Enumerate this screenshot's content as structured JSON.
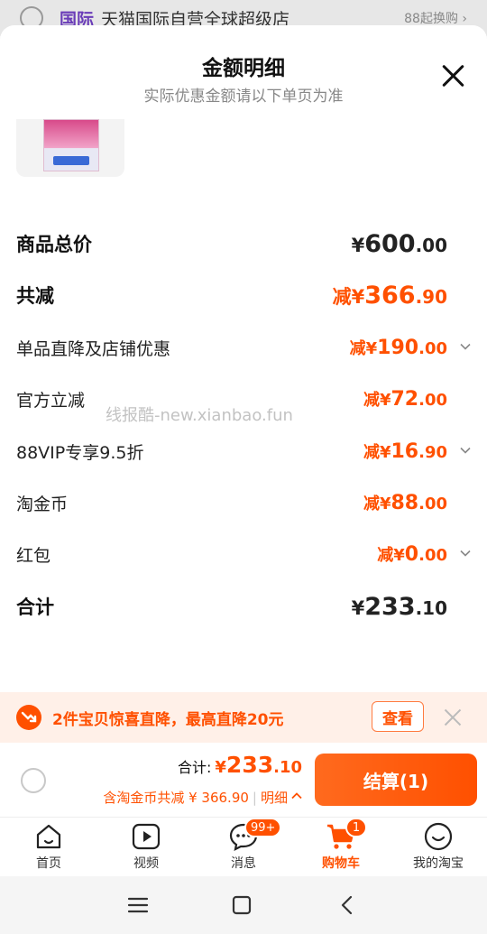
{
  "background_store": {
    "tag": "国际",
    "name": "天猫国际自营全球超级店",
    "suffix": "88起换购 ›"
  },
  "sheet": {
    "title": "金额明细",
    "subtitle": "实际优惠金额请以下单页为准"
  },
  "rows": {
    "goods_total": {
      "label": "商品总价",
      "yen": "¥",
      "int": "600",
      "dec": ".00"
    },
    "total_reduce": {
      "label": "共减",
      "pre": "减",
      "yen": "¥",
      "int": "366",
      "dec": ".90"
    },
    "item_discount": {
      "label": "单品直降及店铺优惠",
      "pre": "减",
      "yen": "¥",
      "int": "190",
      "dec": ".00"
    },
    "official_cut": {
      "label": "官方立减",
      "pre": "减",
      "yen": "¥",
      "int": "72",
      "dec": ".00"
    },
    "vip88": {
      "label": "88VIP专享9.5折",
      "pre": "减",
      "yen": "¥",
      "int": "16",
      "dec": ".90"
    },
    "coins": {
      "label": "淘金币",
      "pre": "减",
      "yen": "¥",
      "int": "88",
      "dec": ".00"
    },
    "redpacket": {
      "label": "红包",
      "pre": "减",
      "yen": "¥",
      "int": "0",
      "dec": ".00"
    },
    "sum": {
      "label": "合计",
      "yen": "¥",
      "int": "233",
      "dec": ".10"
    }
  },
  "watermark": "线报酷-new.xianbao.fun",
  "promo": {
    "text": "2件宝贝惊喜直降，最高直降20元",
    "button": "查看"
  },
  "checkout": {
    "total_label": "合计:",
    "yen": "¥",
    "int": "233",
    "dec": ".10",
    "detail_text": "含淘金币共减 ¥ 366.90",
    "detail_sep": "|",
    "detail_link": "明细",
    "settle": "结算(1)"
  },
  "tabs": [
    {
      "label": "首页",
      "icon": "home-icon"
    },
    {
      "label": "视频",
      "icon": "video-icon"
    },
    {
      "label": "消息",
      "icon": "message-icon",
      "badge": "99+"
    },
    {
      "label": "购物车",
      "icon": "cart-icon",
      "badge": "1"
    },
    {
      "label": "我的淘宝",
      "icon": "profile-icon"
    }
  ],
  "colors": {
    "accent": "#ff5000",
    "promo_bg": "#fff0e8"
  }
}
